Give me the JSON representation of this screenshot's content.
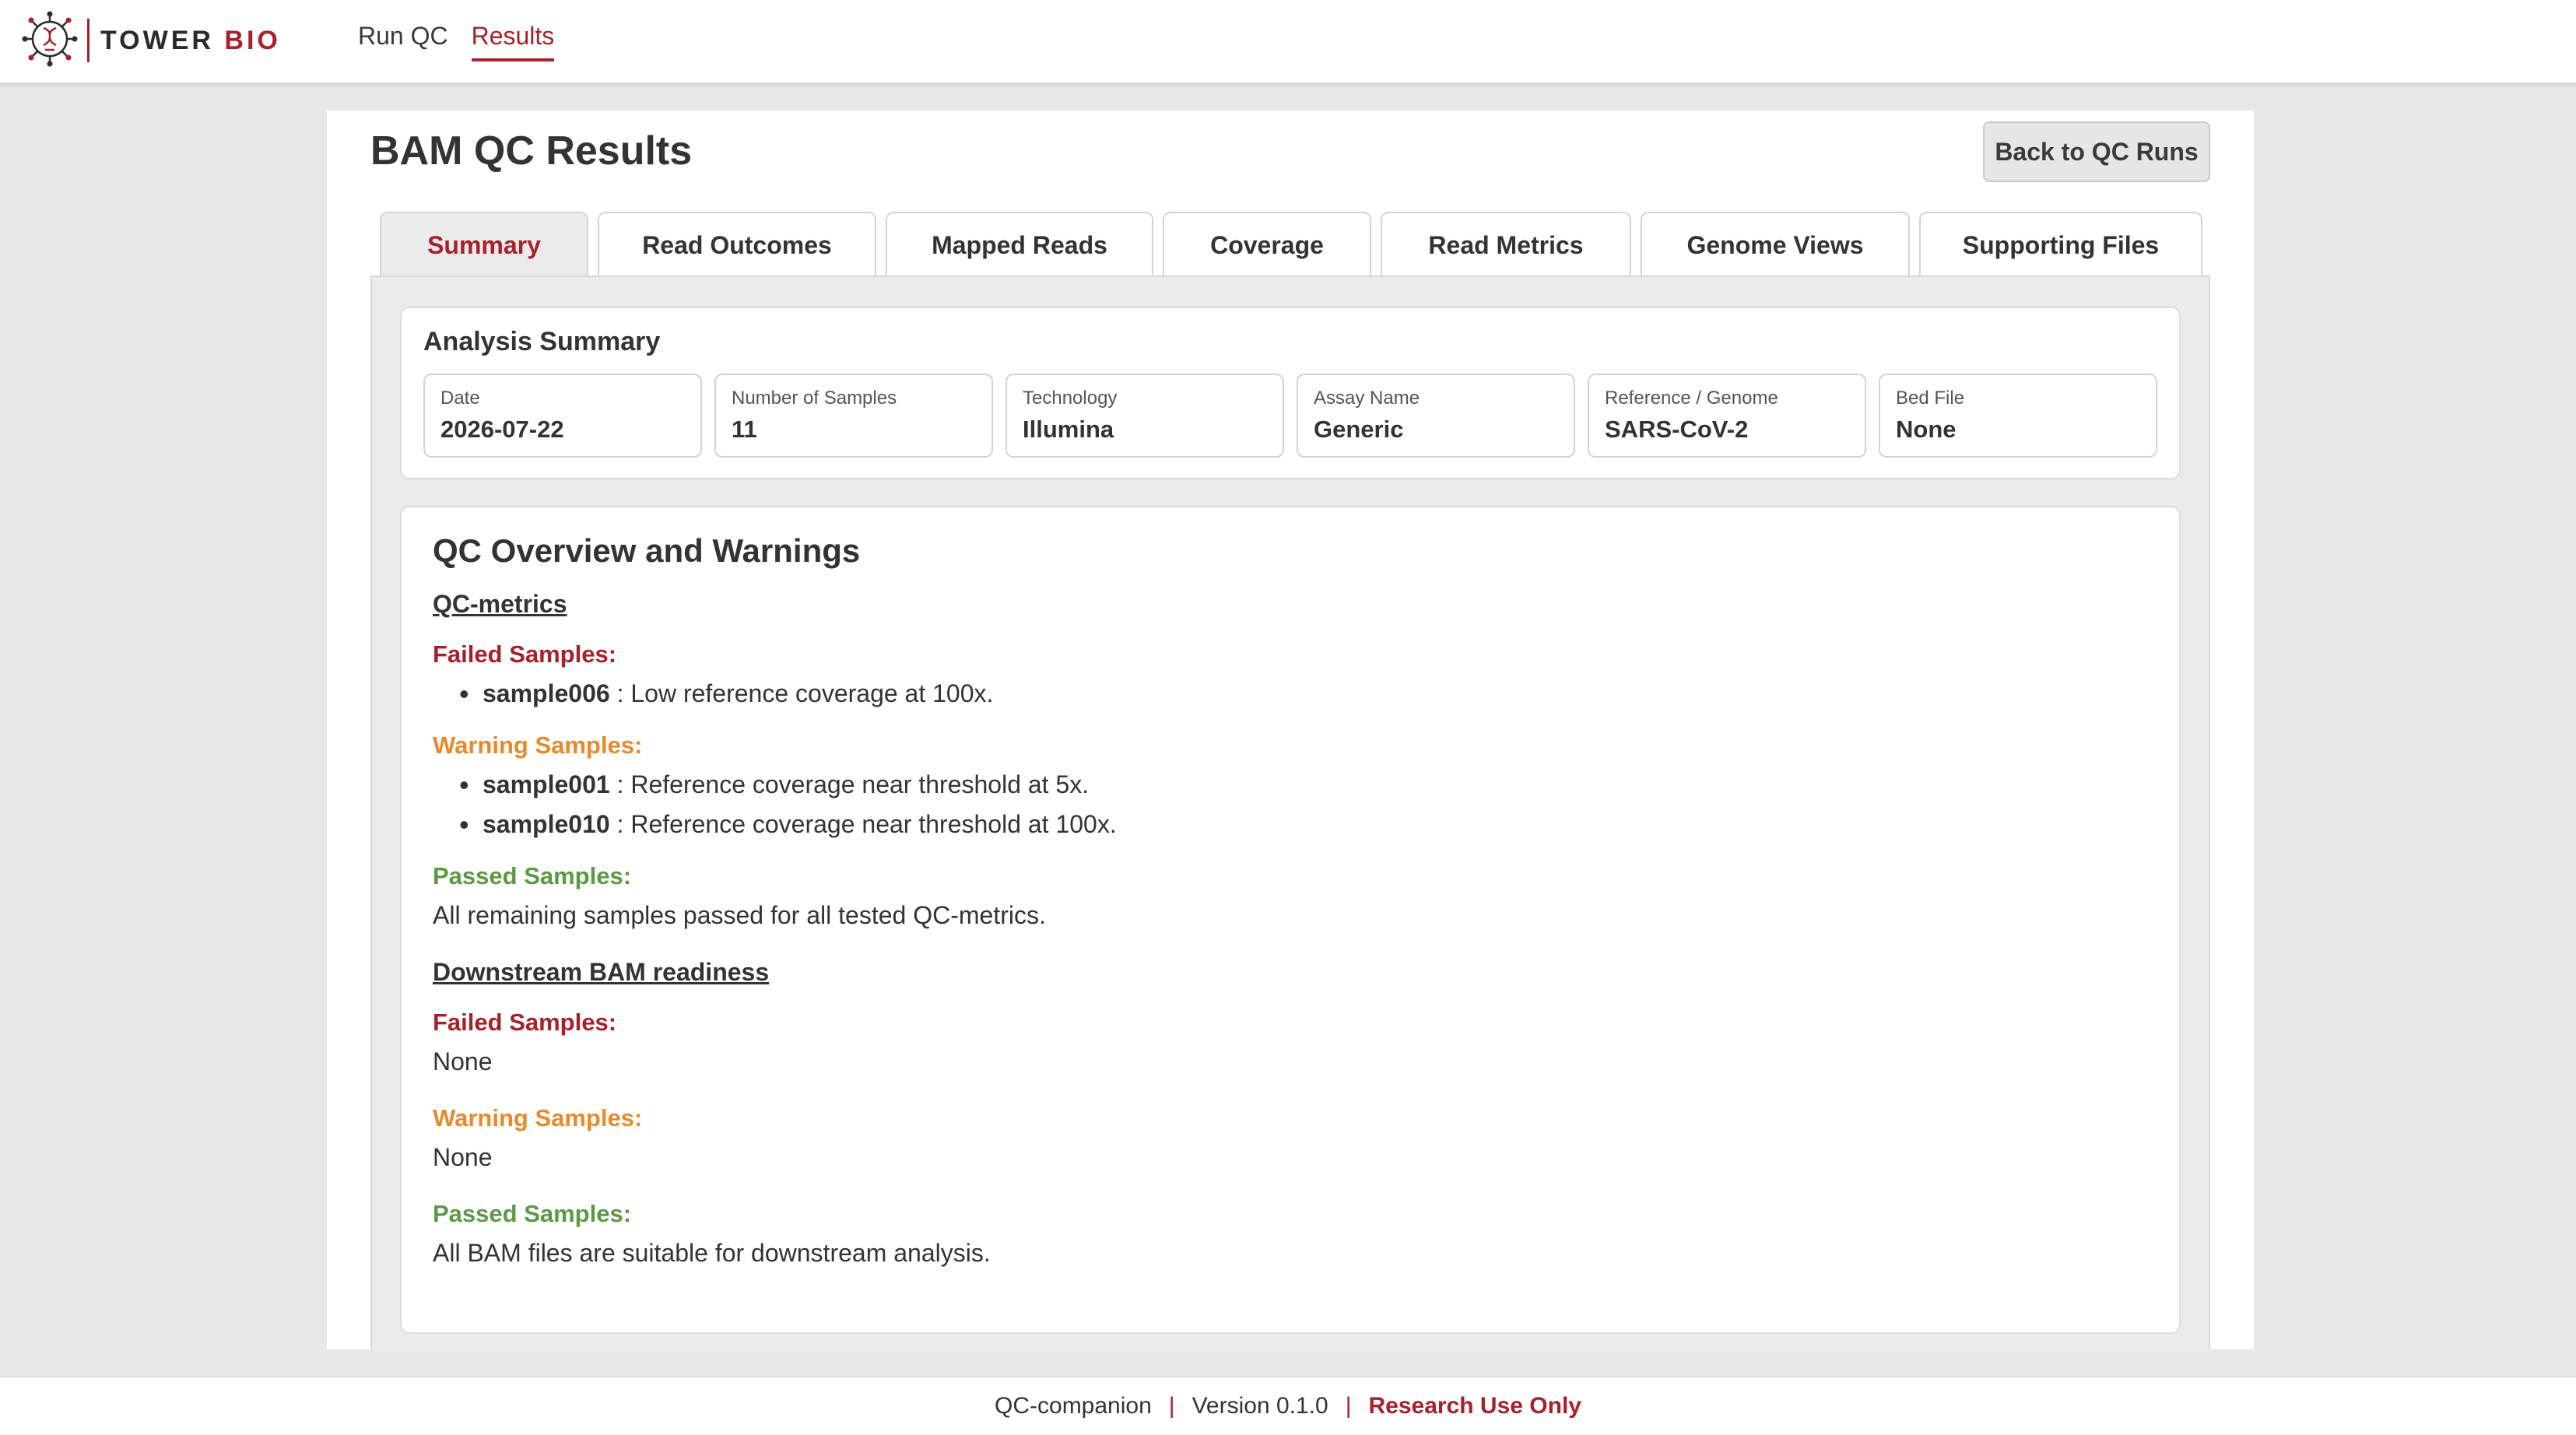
{
  "brand": {
    "name": "TOWER",
    "accent": "BIO",
    "logo_icon": "helix-virus-logo-icon"
  },
  "nav": [
    {
      "label": "Run QC",
      "active": false
    },
    {
      "label": "Results",
      "active": true
    }
  ],
  "page": {
    "title": "BAM QC Results",
    "back_label": "Back to QC Runs"
  },
  "tabs": [
    {
      "label": "Summary",
      "active": true
    },
    {
      "label": "Read Outcomes"
    },
    {
      "label": "Mapped Reads"
    },
    {
      "label": "Coverage"
    },
    {
      "label": "Read Metrics"
    },
    {
      "label": "Genome Views"
    },
    {
      "label": "Supporting Files"
    }
  ],
  "summary": {
    "title": "Analysis Summary",
    "fields": [
      {
        "label": "Date",
        "value": "2026-07-22"
      },
      {
        "label": "Number of Samples",
        "value": "11"
      },
      {
        "label": "Technology",
        "value": "Illumina"
      },
      {
        "label": "Assay Name",
        "value": "Generic"
      },
      {
        "label": "Reference / Genome",
        "value": "SARS-CoV-2"
      },
      {
        "label": "Bed File",
        "value": "None"
      }
    ]
  },
  "qc": {
    "title": "QC Overview and Warnings",
    "metrics": {
      "heading": "QC-metrics",
      "failed_label": "Failed Samples:",
      "failed": [
        {
          "sample": "sample006",
          "text": " : Low reference coverage at 100x."
        }
      ],
      "warning_label": "Warning Samples:",
      "warning": [
        {
          "sample": "sample001",
          "text": " : Reference coverage near threshold at 5x."
        },
        {
          "sample": "sample010",
          "text": " : Reference coverage near threshold at 100x."
        }
      ],
      "passed_label": "Passed Samples:",
      "passed_text": "All remaining samples passed for all tested QC-metrics."
    },
    "readiness": {
      "heading": "Downstream BAM readiness",
      "failed_label": "Failed Samples:",
      "failed_text": "None",
      "warning_label": "Warning Samples:",
      "warning_text": "None",
      "passed_label": "Passed Samples:",
      "passed_text": "All BAM files are suitable for downstream analysis."
    }
  },
  "footer": {
    "app": "QC-companion",
    "separator": "|",
    "version": "Version 0.1.0",
    "notice": "Research Use Only"
  },
  "colors": {
    "accent": "#a8202a",
    "warning": "#e8892a",
    "passed": "#5a9a43"
  }
}
